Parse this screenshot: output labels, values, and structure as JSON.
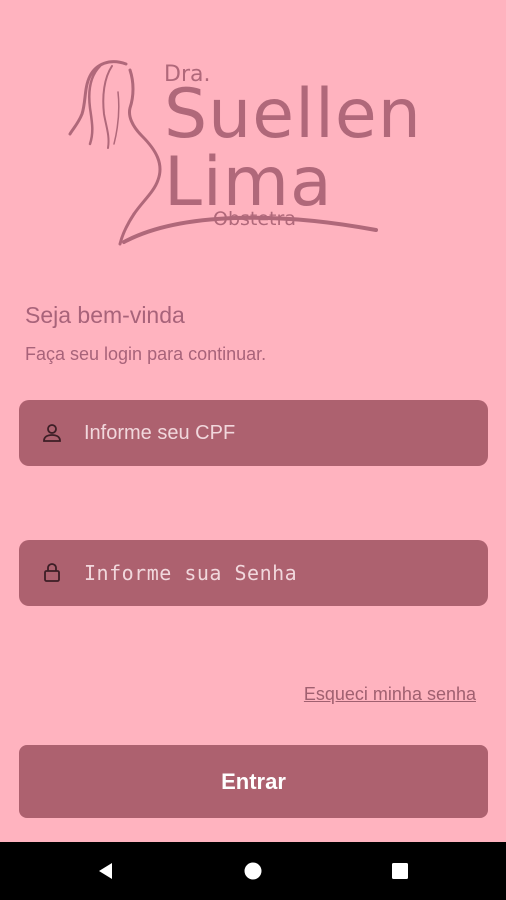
{
  "logo": {
    "prefix": "Dra.",
    "first_name": "Suellen",
    "last_name": "Lima",
    "role": "Obstetra",
    "color": "#b0687a"
  },
  "greeting": {
    "title": "Seja bem-vinda",
    "subtitle": "Faça seu login para continuar."
  },
  "form": {
    "cpf": {
      "placeholder": "Informe seu CPF",
      "value": "",
      "icon": "user-icon"
    },
    "password": {
      "placeholder": "Informe sua Senha",
      "value": "",
      "icon": "lock-icon"
    },
    "forgot_label": "Esqueci minha senha",
    "submit_label": "Entrar"
  },
  "colors": {
    "background": "#ffb3bf",
    "field": "#ad616f",
    "accent_text": "#a8637a"
  },
  "system_nav": {
    "back_icon": "back-triangle-icon",
    "home_icon": "home-circle-icon",
    "recent_icon": "recent-square-icon"
  }
}
